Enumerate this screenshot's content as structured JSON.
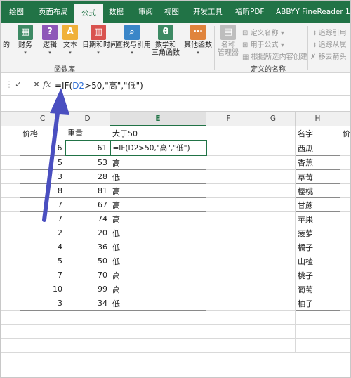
{
  "tabs": [
    "绘图",
    "页面布局",
    "公式",
    "数据",
    "审阅",
    "视图",
    "开发工具",
    "福昕PDF",
    "ABBYY FineReader 12"
  ],
  "ribbon": {
    "buttons": [
      {
        "label": "的",
        "icon": "financial-icon"
      },
      {
        "label": "财务",
        "icon": "financial-icon"
      },
      {
        "label": "逻辑",
        "icon": "logical-icon"
      },
      {
        "label": "文本",
        "icon": "text-icon"
      },
      {
        "label": "日期和时间",
        "icon": "date-time-icon"
      },
      {
        "label": "查找与引用",
        "icon": "lookup-icon"
      },
      {
        "label": "数学和\n三角函数",
        "icon": "math-icon"
      },
      {
        "label": "其他函数",
        "icon": "more-functions-icon"
      }
    ],
    "library_label": "函数库",
    "name_manager_label": "名称\n管理器",
    "define_name": "定义名称",
    "use_in_formula": "用于公式",
    "create_from_selection": "根据所选内容创建",
    "defined_names_label": "定义的名称",
    "trace_precedents": "追踪引用",
    "trace_dependents": "追踪从属",
    "remove_arrows": "移去箭头"
  },
  "formula_bar": {
    "cancel": "✓",
    "enter": "✕",
    "fx": "fx",
    "formula_parts": [
      "=IF(",
      "D2",
      ">50,\"高\",\"低\")"
    ]
  },
  "columns": [
    "C",
    "D",
    "E",
    "F",
    "G",
    "H"
  ],
  "headers": {
    "price": "价格",
    "weight": "重量",
    "gt50": "大于50",
    "name": "名字",
    "extra": "价"
  },
  "editing_formula": "=IF(D2>50,\"高\",\"低\")",
  "rows": [
    {
      "c": "6",
      "d": "61",
      "e": "",
      "h": "西瓜"
    },
    {
      "c": "5",
      "d": "53",
      "e": "高",
      "h": "香蕉"
    },
    {
      "c": "3",
      "d": "28",
      "e": "低",
      "h": "草莓"
    },
    {
      "c": "8",
      "d": "81",
      "e": "高",
      "h": "樱桃"
    },
    {
      "c": "7",
      "d": "67",
      "e": "高",
      "h": "甘蔗"
    },
    {
      "c": "7",
      "d": "74",
      "e": "高",
      "h": "苹果"
    },
    {
      "c": "2",
      "d": "20",
      "e": "低",
      "h": "菠萝"
    },
    {
      "c": "4",
      "d": "36",
      "e": "低",
      "h": "橘子"
    },
    {
      "c": "5",
      "d": "50",
      "e": "低",
      "h": "山楂"
    },
    {
      "c": "7",
      "d": "70",
      "e": "高",
      "h": "桃子"
    },
    {
      "c": "10",
      "d": "99",
      "e": "高",
      "h": "葡萄"
    },
    {
      "c": "3",
      "d": "34",
      "e": "低",
      "h": "柚子"
    }
  ],
  "colors": {
    "excel_green": "#217346",
    "arrow": "#4a4fc0",
    "reference": "#2f6fd6"
  }
}
